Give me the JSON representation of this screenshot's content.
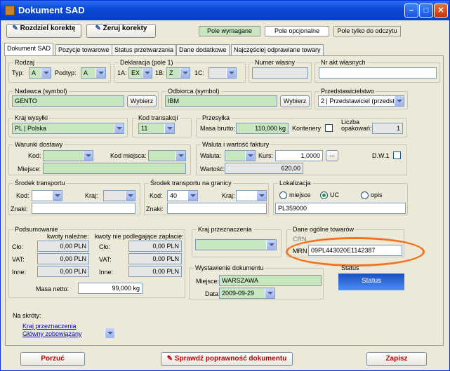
{
  "window": {
    "title": "Dokument SAD"
  },
  "toolbar": {
    "split_label": "Rozdziel korektę",
    "reset_label": "Zeruj korekty"
  },
  "legend": {
    "required": "Pole wymagane",
    "optional": "Pole opcjonalne",
    "readonly": "Pole tylko do odczytu"
  },
  "tabs": [
    "Dokument SAD",
    "Pozycje towarowe",
    "Status przetwarzania",
    "Dane dodatkowe",
    "Najczęściej odprawiane towary"
  ],
  "rodzaj": {
    "title": "Rodzaj",
    "typ_label": "Typ:",
    "typ_value": "A",
    "podtyp_label": "Podtyp:",
    "podtyp_value": "A"
  },
  "deklaracja": {
    "title": "Deklaracja (pole 1)",
    "f1a_label": "1A:",
    "f1a_value": "EX",
    "f1b_label": "1B:",
    "f1b_value": "Z",
    "f1c_label": "1C:",
    "f1c_value": ""
  },
  "numer_wlasny": {
    "title": "Numer własny",
    "value": ""
  },
  "nr_akt": {
    "title": "Nr akt własnych",
    "value": ""
  },
  "nadawca": {
    "title": "Nadawca (symbol)",
    "value": "GENTO",
    "button": "Wybierz"
  },
  "odbiorca": {
    "title": "Odbiorca (symbol)",
    "value": "IBM",
    "button": "Wybierz"
  },
  "przedstawicielstwo": {
    "title": "Przedstawicielstwo",
    "value": "2 | Przedstawiciel (przedst"
  },
  "kraj_wysylki": {
    "title": "Kraj wysyłki",
    "value": "PL | Polska"
  },
  "kod_transakcji": {
    "title": "Kod transakcji",
    "value": "11"
  },
  "przesylka": {
    "title": "Przesyłka",
    "masa_label": "Masa brutto:",
    "masa_value": "110,000 kg",
    "kontenery_label": "Kontenery",
    "liczba_label": "Liczba opakowań:",
    "liczba_value": "1"
  },
  "warunki": {
    "title": "Warunki dostawy",
    "kod_label": "Kod:",
    "kod_miejsca_label": "Kod miejsca:",
    "miejsce_label": "Miejsce:"
  },
  "waluta": {
    "title": "Waluta i wartość faktury",
    "waluta_label": "Waluta:",
    "kurs_label": "Kurs:",
    "kurs_value": "1,0000",
    "browse": "...",
    "wartosc_label": "Wartość:",
    "wartosc_value": "620,00",
    "dw_label": "D.W.1"
  },
  "srodek": {
    "title": "Środek transportu",
    "kod_label": "Kod:",
    "kraj_label": "Kraj:",
    "znaki_label": "Znaki:"
  },
  "srodek_granica": {
    "title": "Środek transportu na granicy",
    "kod_label": "Kod:",
    "kod_value": "40",
    "kraj_label": "Kraj:",
    "znaki_label": "Znaki:"
  },
  "lokalizacja": {
    "title": "Lokalizacja",
    "opt1": "miejsce",
    "opt2": "UC",
    "opt3": "opis",
    "value": "PL359000"
  },
  "podsumowanie": {
    "title": "Podsumowanie",
    "col1": "kwoty należne:",
    "col2": "kwoty nie podlegające zapłacie:",
    "rows": [
      {
        "label": "Cło:",
        "v1": "0,00 PLN",
        "v2": "0,00 PLN"
      },
      {
        "label": "VAT:",
        "v1": "0,00 PLN",
        "v2": "0,00 PLN"
      },
      {
        "label": "Inne:",
        "v1": "0,00 PLN",
        "v2": "0,00 PLN"
      }
    ],
    "masa_netto_label": "Masa netto:",
    "masa_netto_value": "99,000 kg"
  },
  "kraj_przeznaczenia": {
    "title": "Kraj przeznaczenia",
    "value": ""
  },
  "dane_ogolne": {
    "title": "Dane ogólne towarów",
    "crn_label": "CRN",
    "mrn_label": "MRN",
    "mrn_value": "09PL443020E1142387"
  },
  "wystawienie": {
    "title": "Wystawienie dokumentu",
    "miejsce_label": "Miejsce:",
    "miejsce_value": "WARSZAWA",
    "data_label": "Data:",
    "data_value": "2009-09-29"
  },
  "status": {
    "title": "Status",
    "value": "Status"
  },
  "skroty": {
    "title": "Na skróty:",
    "links": [
      "Kraj przeznaczenia",
      "Główny zobowiązany"
    ]
  },
  "footer": {
    "cancel": "Porzuć",
    "check": "Sprawdź poprawność dokumentu",
    "save": "Zapisz"
  },
  "colors": {
    "required": "#c8e6c0",
    "readonly": "#e6e6e6",
    "title_bar": "#0a49d6",
    "highlight": "#f07422",
    "check_text": "#c00000"
  }
}
